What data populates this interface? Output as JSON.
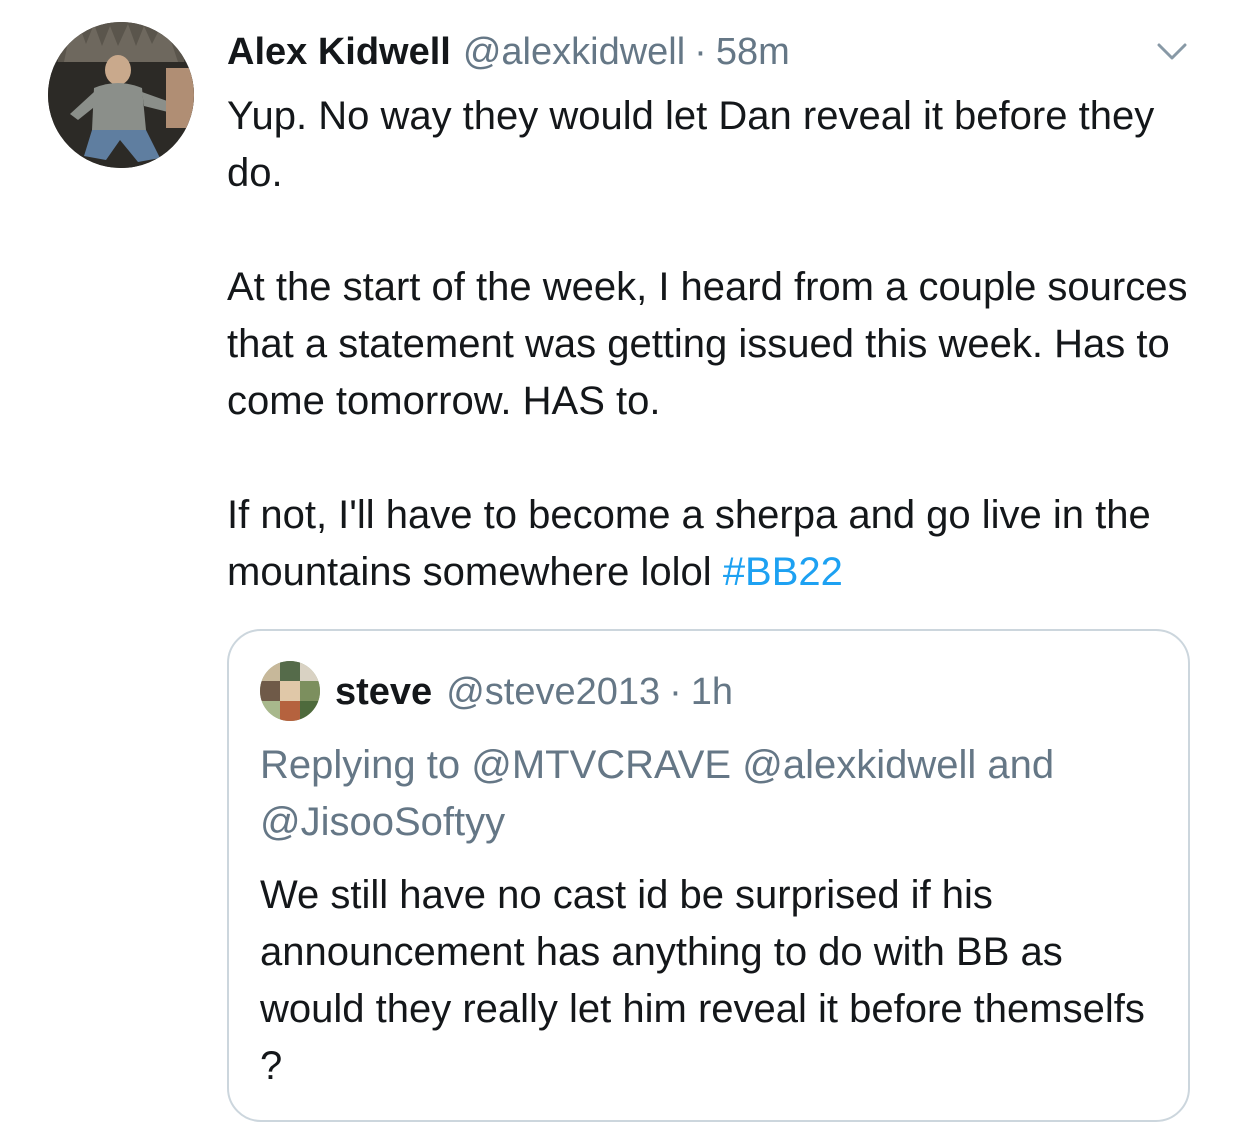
{
  "tweet": {
    "author_name": "Alex Kidwell",
    "author_handle": "@alexkidwell",
    "separator": "·",
    "time": "58m",
    "menu_icon": "chevron-down-icon",
    "paragraphs": [
      "Yup. No way they would let Dan reveal it before they do.",
      "At the start of the week, I heard from a couple sources that a statement was getting issued this week. Has to come tomorrow. HAS to.",
      "If not, I'll have to become a sherpa and go live in the mountains somewhere lolol"
    ],
    "hashtag": "#BB22"
  },
  "quoted_tweet": {
    "author_name": "steve",
    "author_handle": "@steve2013",
    "separator": "·",
    "time": "1h",
    "replying_to": "Replying to @MTVCRAVE @alexkidwell and @JisooSoftyy",
    "text": "We still have no cast id be surprised if his announcement has anything to do with BB as would they really let him reveal it before themselfs ?"
  },
  "colors": {
    "text": "#14171a",
    "secondary": "#657786",
    "link": "#1da1f2",
    "border": "#ccd6dd"
  }
}
